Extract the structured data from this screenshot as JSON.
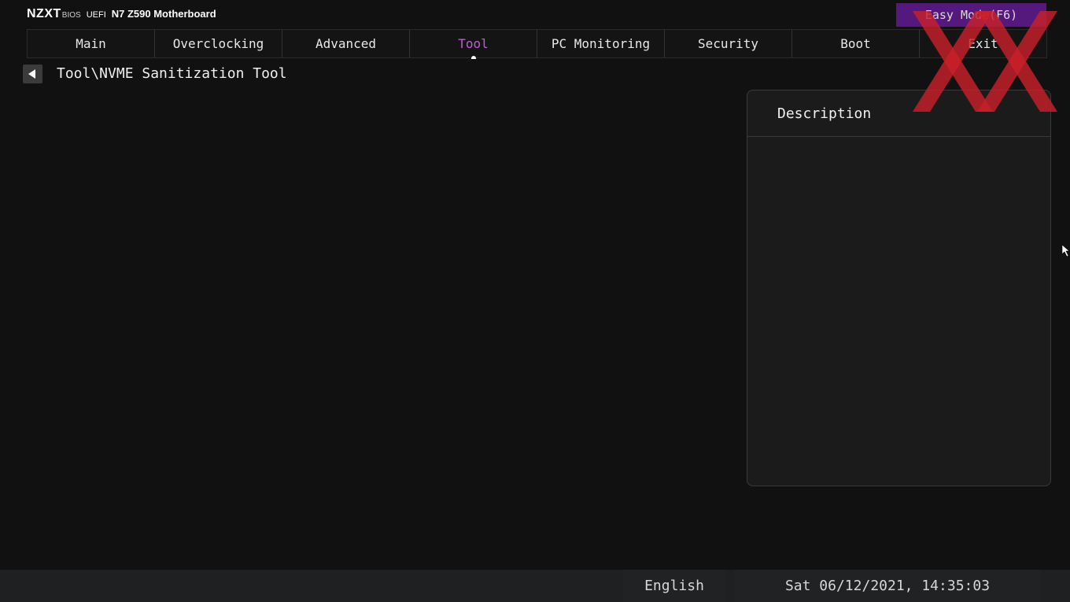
{
  "header": {
    "logo": "NZXT",
    "bios_label": "BIOS",
    "uefi_label": "UEFI",
    "model": "N7 Z590 Motherboard",
    "easy_mode_label": "Easy Mode(F6)"
  },
  "tabs": [
    {
      "label": "Main"
    },
    {
      "label": "Overclocking"
    },
    {
      "label": "Advanced"
    },
    {
      "label": "Tool",
      "active": true
    },
    {
      "label": "PC Monitoring"
    },
    {
      "label": "Security"
    },
    {
      "label": "Boot"
    },
    {
      "label": "Exit"
    }
  ],
  "breadcrumb": {
    "path": "Tool\\NVME Sanitization Tool",
    "back_icon": "back-arrow-icon"
  },
  "description": {
    "title": "Description",
    "body": ""
  },
  "footer": {
    "language": "English",
    "datetime": "Sat 06/12/2021, 14:35:03"
  },
  "colors": {
    "background": "#111111",
    "accent_purple": "#55197e",
    "active_tab": "#c25bd8",
    "watermark_red": "#c8202a"
  }
}
